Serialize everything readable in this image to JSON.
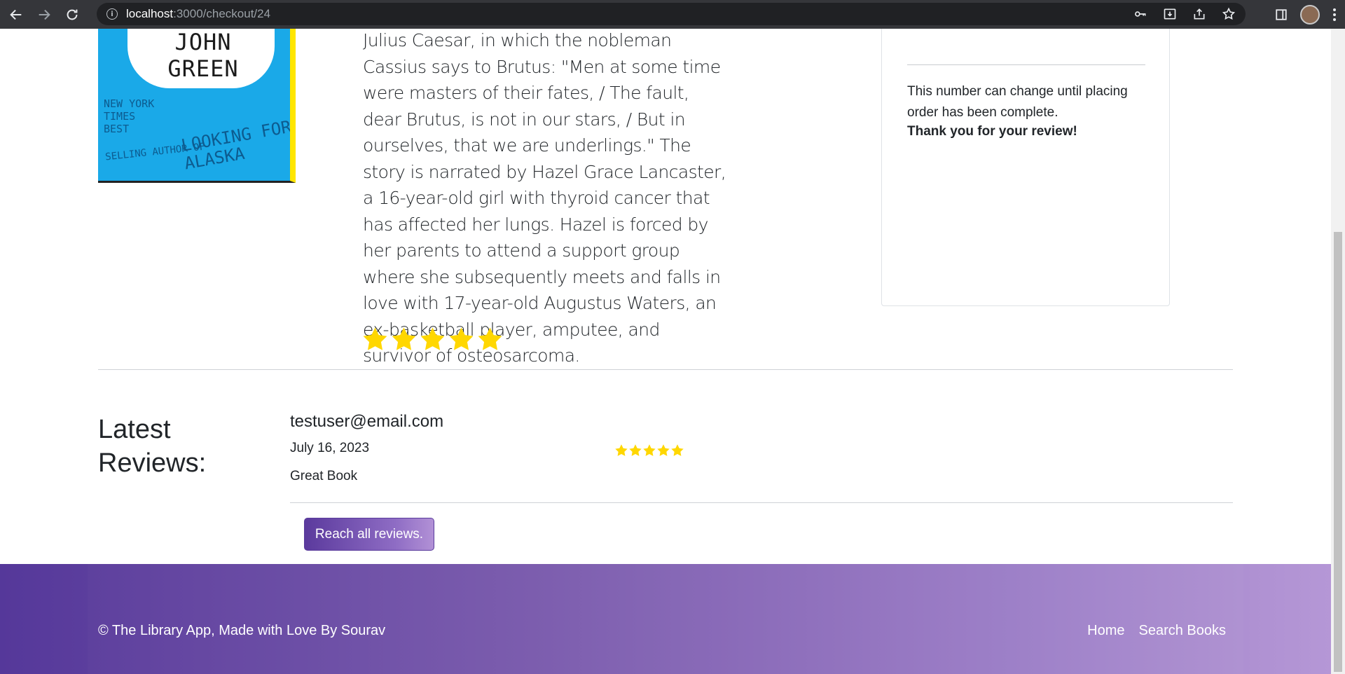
{
  "browser": {
    "url_host": "localhost",
    "url_path": ":3000/checkout/24",
    "icons": [
      "back-icon",
      "forward-icon",
      "reload-icon",
      "info-icon",
      "key-icon",
      "install-icon",
      "share-icon",
      "star-icon",
      "sidebar-icon",
      "menu-icon"
    ]
  },
  "book": {
    "cover_author": "JOHN GREEN",
    "cover_line_1": "NEW YORK TIMES BEST",
    "cover_line_2": "SELLING AUTHOR OF",
    "cover_line_3": "LOOKING FOR ALASKA",
    "description": "Julius Caesar, in which the nobleman Cassius says to Brutus: \"Men at some time were masters of their fates, / The fault, dear Brutus, is not in our stars, / But in ourselves, that we are underlings.\" The story is narrated by Hazel Grace Lancaster, a 16-year-old girl with thyroid cancer that has affected her lungs. Hazel is forced by her parents to attend a support group where she subsequently meets and falls in love with 17-year-old Augustus Waters, an ex-basketball player, amputee, and survivor of osteosarcoma.",
    "rating": 5,
    "star_color": "#ffd700"
  },
  "side_card": {
    "note": "This number can change until placing order has been complete.",
    "thanks": "Thank you for your review!"
  },
  "reviews": {
    "title": "Latest Reviews:",
    "items": [
      {
        "email": "testuser@email.com",
        "date": "July 16, 2023",
        "rating": 5,
        "text": "Great Book"
      }
    ],
    "reach_all_label": "Reach all reviews."
  },
  "footer": {
    "copyright": "© The Library App, Made with Love By Sourav",
    "links": [
      "Home",
      "Search Books"
    ]
  },
  "colors": {
    "footer_start": "#55389a",
    "footer_end": "#b597d6",
    "button_start": "#5b3a9d",
    "button_end": "#b291d6"
  }
}
